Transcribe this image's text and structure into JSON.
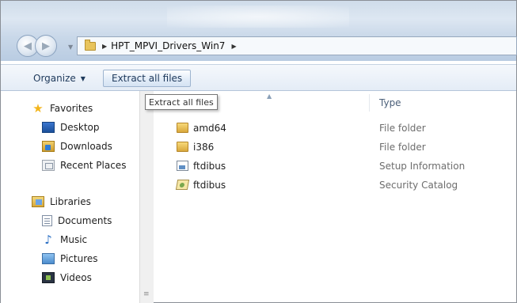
{
  "address": {
    "path": "HPT_MPVI_Drivers_Win7"
  },
  "toolbar": {
    "organize_label": "Organize",
    "extract_label": "Extract all files"
  },
  "tooltip": {
    "text": "Extract all files"
  },
  "nav": {
    "favorites_label": "Favorites",
    "favorites": [
      {
        "label": "Desktop",
        "icon": "desktop-icon"
      },
      {
        "label": "Downloads",
        "icon": "downloads-icon"
      },
      {
        "label": "Recent Places",
        "icon": "recent-places-icon"
      }
    ],
    "libraries_label": "Libraries",
    "libraries": [
      {
        "label": "Documents",
        "icon": "documents-icon"
      },
      {
        "label": "Music",
        "icon": "music-icon"
      },
      {
        "label": "Pictures",
        "icon": "pictures-icon"
      },
      {
        "label": "Videos",
        "icon": "videos-icon"
      }
    ]
  },
  "columns": {
    "type_header": "Type"
  },
  "files": [
    {
      "name": "amd64",
      "type": "File folder",
      "icon": "folder-icon"
    },
    {
      "name": "i386",
      "type": "File folder",
      "icon": "folder-icon"
    },
    {
      "name": "ftdibus",
      "type": "Setup Information",
      "icon": "setup-information-icon"
    },
    {
      "name": "ftdibus",
      "type": "Security Catalog",
      "icon": "security-catalog-icon"
    }
  ],
  "colors": {
    "command_text": "#1e395b",
    "type_text": "#6d6d6d",
    "folder": "#e8c45c"
  }
}
